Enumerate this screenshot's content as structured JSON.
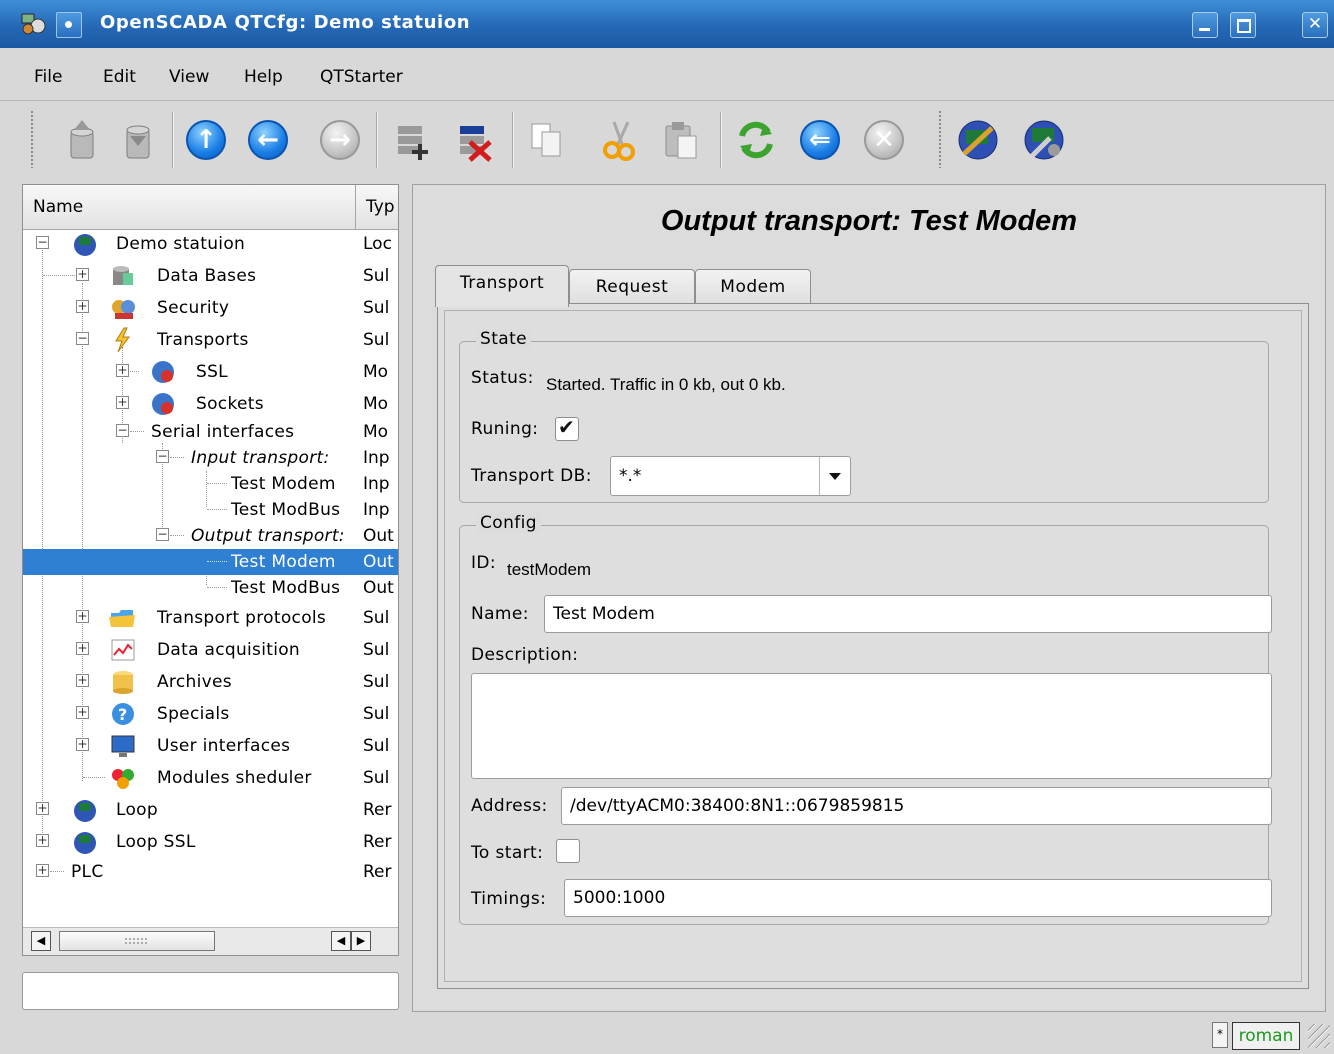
{
  "window": {
    "title": "OpenSCADA QTCfg: Demo statuion"
  },
  "menubar": {
    "items": [
      {
        "label": "File"
      },
      {
        "label": "Edit"
      },
      {
        "label": "View"
      },
      {
        "label": "Help"
      },
      {
        "label": "QTStarter"
      }
    ]
  },
  "toolbar": {
    "icons": [
      "db-load-icon",
      "db-save-icon",
      "up-arrow-icon",
      "back-arrow-icon",
      "forward-arrow-icon",
      "item-add-icon",
      "item-delete-icon",
      "copy-icon",
      "cut-icon",
      "paste-icon",
      "refresh-icon",
      "previous-icon",
      "stop-icon",
      "station-cfg-icon",
      "station-run-icon"
    ]
  },
  "tree": {
    "header_name": "Name",
    "header_type": "Typ",
    "rows": [
      {
        "label": "Demo statuion",
        "type": "Loc"
      },
      {
        "label": "Data Bases",
        "type": "Sul"
      },
      {
        "label": "Security",
        "type": "Sul"
      },
      {
        "label": "Transports",
        "type": "Sul"
      },
      {
        "label": "SSL",
        "type": "Mo"
      },
      {
        "label": "Sockets",
        "type": "Mo"
      },
      {
        "label": "Serial interfaces",
        "type": "Mo"
      },
      {
        "label": "Input transport:",
        "type": "Inp"
      },
      {
        "label": "Test Modem",
        "type": "Inp"
      },
      {
        "label": "Test ModBus",
        "type": "Inp"
      },
      {
        "label": "Output transport:",
        "type": "Out"
      },
      {
        "label": "Test Modem",
        "type": "Out"
      },
      {
        "label": "Test ModBus",
        "type": "Out"
      },
      {
        "label": "Transport protocols",
        "type": "Sul"
      },
      {
        "label": "Data acquisition",
        "type": "Sul"
      },
      {
        "label": "Archives",
        "type": "Sul"
      },
      {
        "label": "Specials",
        "type": "Sul"
      },
      {
        "label": "User interfaces",
        "type": "Sul"
      },
      {
        "label": "Modules sheduler",
        "type": "Sul"
      },
      {
        "label": "Loop",
        "type": "Rer"
      },
      {
        "label": "Loop SSL",
        "type": "Rer"
      },
      {
        "label": "PLC",
        "type": "Rer"
      }
    ]
  },
  "page": {
    "title": "Output transport: Test Modem",
    "tabs": [
      {
        "label": "Transport"
      },
      {
        "label": "Request"
      },
      {
        "label": "Modem"
      }
    ],
    "state": {
      "group_title": "State",
      "status_label": "Status:",
      "status_value": "Started. Traffic in 0 kb, out 0 kb.",
      "running_label": "Runing:",
      "running": true,
      "db_label": "Transport DB:",
      "db_value": "*.*"
    },
    "config": {
      "group_title": "Config",
      "id_label": "ID:",
      "id_value": "testModem",
      "name_label": "Name:",
      "name_value": "Test Modem",
      "description_label": "Description:",
      "description_value": "",
      "address_label": "Address:",
      "address_value": "/dev/ttyACM0:38400:8N1::0679859815",
      "to_start_label": "To start:",
      "to_start": false,
      "timings_label": "Timings:",
      "timings_value": "5000:1000"
    }
  },
  "statusbar": {
    "modified_indicator": "*",
    "user": "roman"
  }
}
